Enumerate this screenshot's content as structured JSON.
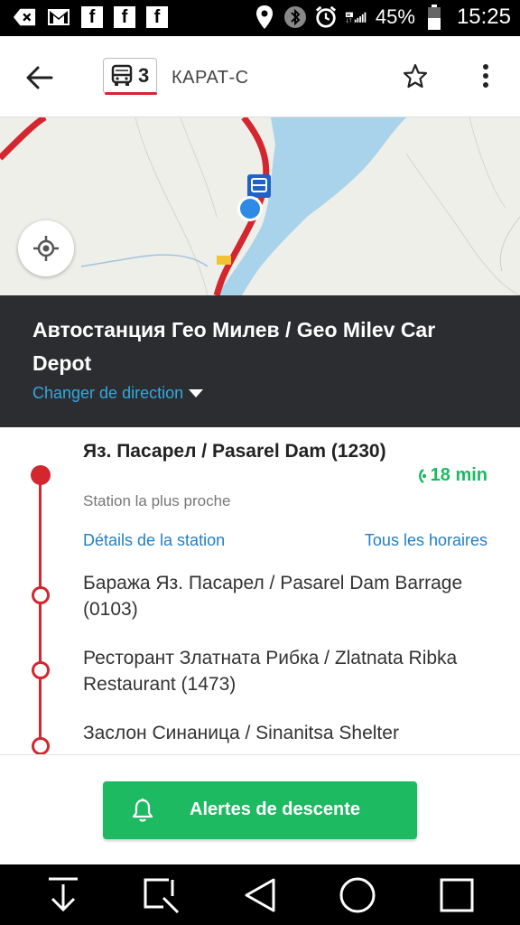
{
  "status_bar": {
    "battery": "45%",
    "time": "15:25",
    "icons": [
      "back-icon",
      "gmail-icon",
      "facebook-icon",
      "facebook-icon",
      "facebook-icon",
      "location-icon",
      "bluetooth-icon",
      "alarm-icon",
      "signal-icon",
      "battery-icon"
    ]
  },
  "app_bar": {
    "route_number": "3",
    "line_name": "КАРАТ-С"
  },
  "station": {
    "title": "Автостанция Гео Милев / Geo Milev Car Depot",
    "change_direction": "Changer de direction"
  },
  "stops": {
    "current": {
      "name": "Яз. Пасарел / Pasarel Dam (1230)",
      "subtitle": "Station la plus proche",
      "eta": "18 min",
      "details_link": "Détails de la station",
      "timetable_link": "Tous les horaires"
    },
    "next": [
      {
        "name": "Баража Яз. Пасарел / Pasarel Dam Barrage (0103)"
      },
      {
        "name": "Ресторант Златната Рибка / Zlatnata Ribka Restaurant (1473)"
      },
      {
        "name": "Заслон Синаница / Sinanitsa Shelter"
      }
    ]
  },
  "action": {
    "label": "Alertes de descente"
  },
  "colors": {
    "route_red": "#d3262f",
    "accent_green": "#1dba62",
    "link_blue": "#1e7fc8",
    "header_dark": "#2b2d31"
  }
}
